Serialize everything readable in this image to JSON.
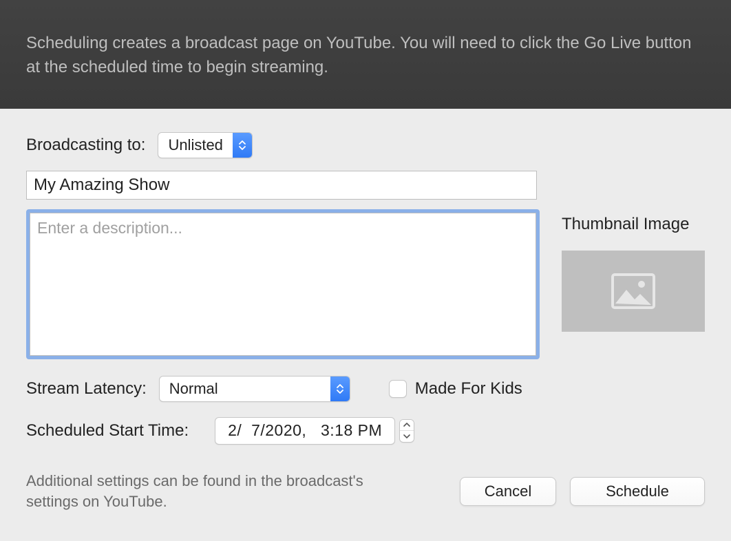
{
  "header": {
    "info_text": "Scheduling creates a broadcast page on YouTube. You will need to click the Go Live button at the scheduled time to begin streaming."
  },
  "broadcasting": {
    "label": "Broadcasting to:",
    "selected": "Unlisted"
  },
  "title_field": {
    "value": "My Amazing Show"
  },
  "description": {
    "value": "",
    "placeholder": "Enter a description..."
  },
  "thumbnail": {
    "label": "Thumbnail Image"
  },
  "latency": {
    "label": "Stream Latency:",
    "selected": "Normal"
  },
  "made_for_kids": {
    "label": "Made For Kids",
    "checked": false
  },
  "scheduled_time": {
    "label": "Scheduled Start Time:",
    "value": "2/  7/2020,   3:18 PM"
  },
  "footer": {
    "note": "Additional settings can be found in the broadcast's settings on YouTube.",
    "cancel": "Cancel",
    "schedule": "Schedule"
  }
}
